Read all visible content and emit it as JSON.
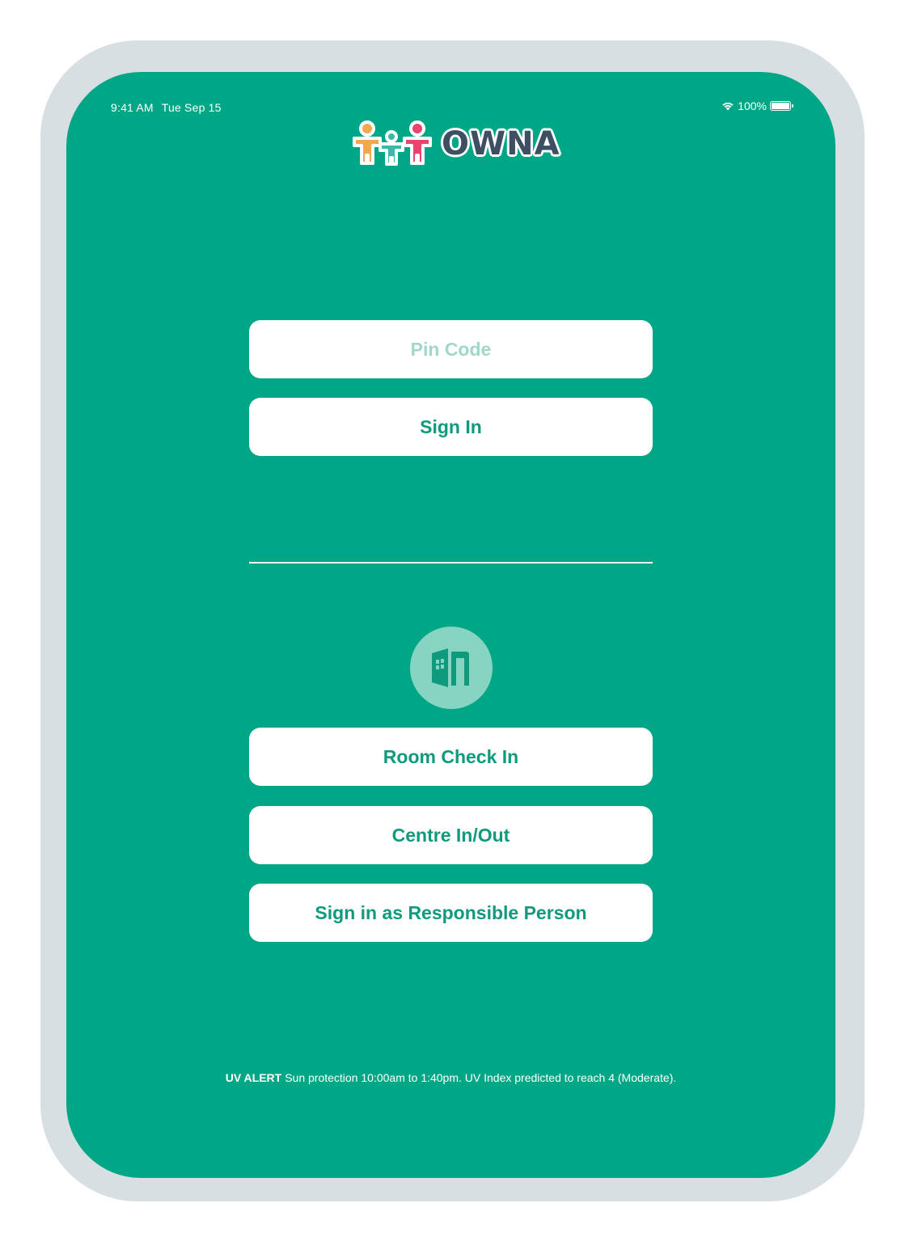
{
  "status_bar": {
    "time": "9:41 AM",
    "date": "Tue Sep 15",
    "battery_percent": "100%",
    "wifi_icon": "wifi-icon",
    "battery_icon": "battery-icon"
  },
  "brand": {
    "name": "OWNA",
    "primary_color": "#00a786",
    "text_color": "#0e9a7d"
  },
  "login": {
    "pin_placeholder": "Pin Code",
    "sign_in_label": "Sign In"
  },
  "room_section": {
    "icon": "room-door-icon",
    "room_check_in_label": "Room Check In",
    "centre_in_out_label": "Centre In/Out",
    "responsible_person_label": "Sign in as Responsible Person"
  },
  "uv_alert": {
    "title": "UV ALERT",
    "message": "Sun protection 10:00am to 1:40pm. UV Index predicted to reach 4 (Moderate)."
  }
}
